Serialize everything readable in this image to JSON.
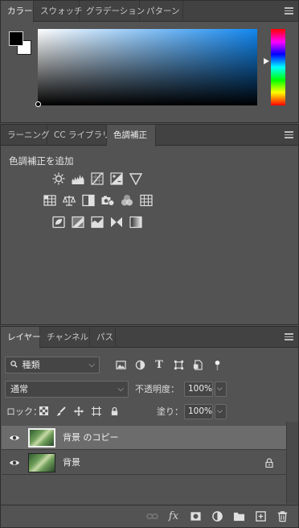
{
  "color_panel": {
    "tabs": [
      "カラー",
      "スウォッチ",
      "グラデーション",
      "パターン"
    ],
    "active_tab": 0,
    "foreground_color": "#000000",
    "background_color": "#ffffff",
    "picker_hue_color": "#1187f0"
  },
  "adjustments_panel": {
    "tabs": [
      "ラーニング",
      "CC ライブラリ",
      "色調補正"
    ],
    "active_tab": 2,
    "title": "色調補正を追加",
    "icon_rows": [
      [
        "brightness-contrast-icon",
        "levels-icon",
        "curves-icon",
        "exposure-icon",
        "vibrance-icon"
      ],
      [
        "hue-saturation-icon",
        "color-balance-icon",
        "black-white-icon",
        "photo-filter-icon",
        "channel-mixer-icon",
        "color-lookup-icon"
      ],
      [
        "invert-icon",
        "posterize-icon",
        "threshold-icon",
        "selective-color-icon",
        "gradient-map-icon"
      ]
    ]
  },
  "layers_panel": {
    "tabs": [
      "レイヤー",
      "チャンネル",
      "パス"
    ],
    "active_tab": 0,
    "filter": {
      "label": "種類"
    },
    "blend_mode": "通常",
    "opacity": {
      "label": "不透明度：",
      "value": "100%"
    },
    "lock": {
      "label": "ロック："
    },
    "fill": {
      "label": "塗り：",
      "value": "100%"
    },
    "layers": [
      {
        "name": "背景 のコピー",
        "selected": true,
        "locked": false
      },
      {
        "name": "背景",
        "selected": false,
        "locked": true
      }
    ]
  }
}
